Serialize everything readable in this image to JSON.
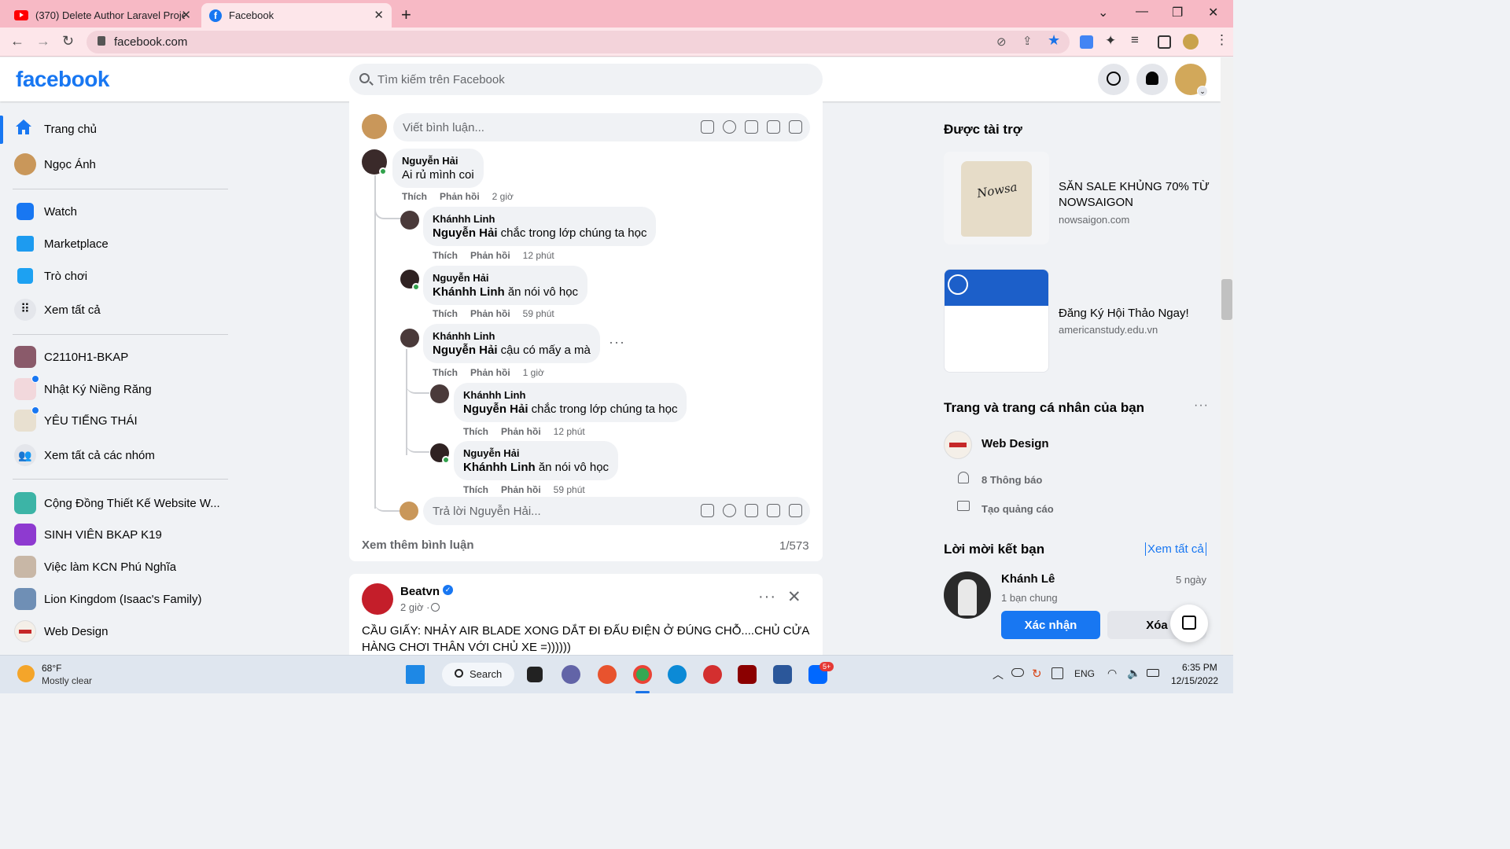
{
  "browser": {
    "tabs": [
      {
        "title": "(370) Delete Author Laravel Proje"
      },
      {
        "title": "Facebook"
      }
    ],
    "url": "facebook.com"
  },
  "fb": {
    "logo": "facebook",
    "search_placeholder": "Tìm kiếm trên Facebook"
  },
  "sidebar": {
    "items": [
      {
        "label": "Trang chủ",
        "icon": "home-icon"
      },
      {
        "label": "Ngọc Ánh",
        "icon": "profile-avatar"
      },
      {
        "label": "Watch",
        "icon": "watch-icon"
      },
      {
        "label": "Marketplace",
        "icon": "marketplace-icon"
      },
      {
        "label": "Trò chơi",
        "icon": "gaming-icon"
      },
      {
        "label": "Xem tất cả",
        "icon": "grid-icon"
      },
      {
        "label": "C2110H1-BKAP",
        "icon": "group-avatar"
      },
      {
        "label": "Nhật Ký Niềng Răng",
        "icon": "group-avatar"
      },
      {
        "label": "YÊU TIẾNG THÁI",
        "icon": "group-avatar"
      },
      {
        "label": "Xem tất cả các nhóm",
        "icon": "groups-icon"
      },
      {
        "label": "Cộng Đồng Thiết Kế Website W...",
        "icon": "group-avatar"
      },
      {
        "label": "SINH VIÊN BKAP K19",
        "icon": "group-avatar"
      },
      {
        "label": "Việc làm KCN Phú Nghĩa",
        "icon": "group-avatar"
      },
      {
        "label": "Lion Kingdom (Isaac's Family)",
        "icon": "group-avatar"
      },
      {
        "label": "Web Design",
        "icon": "page-avatar"
      }
    ]
  },
  "post1": {
    "comment_placeholder": "Viết bình luận...",
    "comments": [
      {
        "name": "Nguyễn Hải",
        "mention": "",
        "text": "Ai rủ mình coi",
        "like": "Thích",
        "reply": "Phản hồi",
        "time": "2 giờ"
      },
      {
        "name": "Khánhh Linh",
        "mention": "Nguyễn Hải",
        "text": " chắc trong lớp chúng ta học",
        "like": "Thích",
        "reply": "Phản hồi",
        "time": "12 phút"
      },
      {
        "name": "Nguyễn Hải",
        "mention": "Khánhh Linh",
        "text": " ăn nói vô học",
        "like": "Thích",
        "reply": "Phản hồi",
        "time": "59 phút"
      },
      {
        "name": "Khánhh Linh",
        "mention": "Nguyễn Hải",
        "text": " cậu có mấy a mà",
        "like": "Thích",
        "reply": "Phản hồi",
        "time": "1 giờ"
      },
      {
        "name": "Khánhh Linh",
        "mention": "Nguyễn Hải",
        "text": " chắc trong lớp chúng ta học",
        "like": "Thích",
        "reply": "Phản hồi",
        "time": "12 phút"
      },
      {
        "name": "Nguyễn Hải",
        "mention": "Khánhh Linh",
        "text": " ăn nói vô học",
        "like": "Thích",
        "reply": "Phản hồi",
        "time": "59 phút"
      }
    ],
    "reply_placeholder": "Trả lời Nguyễn Hải...",
    "more_comments": "Xem thêm bình luận",
    "count": "1/573"
  },
  "post2": {
    "author": "Beatvn",
    "time": "2 giờ ·",
    "text": "CẦU GIẤY: NHẢY AIR BLADE XONG DẮT ĐI ĐẤU ĐIỆN Ở ĐÚNG CHỖ....CHỦ CỬA HÀNG CHƠI THÂN VỚI CHỦ XE =))))))"
  },
  "right": {
    "sponsored_title": "Được tài trợ",
    "ads": [
      {
        "title": "SĂN SALE KHỦNG 70% TỪ NOWSAIGON",
        "url": "nowsaigon.com"
      },
      {
        "title": "Đăng Ký Hội Thảo Ngay!",
        "url": "americanstudy.edu.vn"
      }
    ],
    "pages_title": "Trang và trang cá nhân của bạn",
    "page_name": "Web Design",
    "notifications": "8 Thông báo",
    "create_ad": "Tạo quảng cáo",
    "friend_req_title": "Lời mời kết bạn",
    "see_all": "Xem tất cả",
    "friend": {
      "name": "Khánh Lê",
      "time": "5 ngày",
      "mutual": "1 bạn chung"
    },
    "confirm": "Xác nhận",
    "delete": "Xóa"
  },
  "taskbar": {
    "weather_temp": "68°F",
    "weather_desc": "Mostly clear",
    "search": "Search",
    "lang": "ENG",
    "time": "6:35 PM",
    "date": "12/15/2022",
    "badge": "5+"
  },
  "colors": {
    "fb_blue": "#1877f2",
    "tab_pink": "#f7b9c5"
  }
}
